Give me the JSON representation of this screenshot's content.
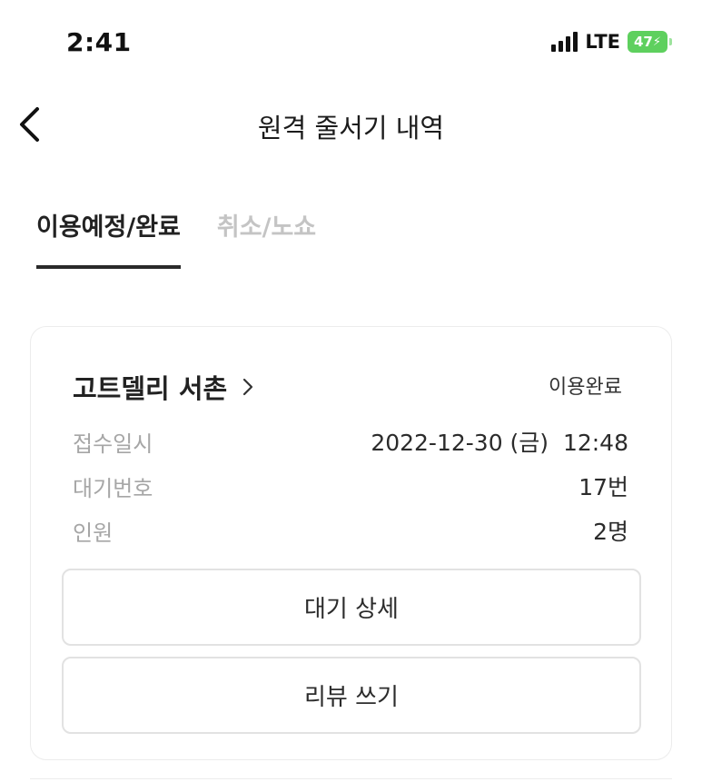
{
  "status_bar": {
    "time": "2:41",
    "network": "LTE",
    "battery_level": "47",
    "battery_color": "#5ed05e",
    "icons": [
      "signal-icon",
      "battery-charging-icon"
    ]
  },
  "header": {
    "back_icon": "chevron-left-icon",
    "title": "원격 줄서기 내역"
  },
  "tabs": [
    {
      "label": "이용예정/완료",
      "active": true
    },
    {
      "label": "취소/노쇼",
      "active": false
    }
  ],
  "reservation": {
    "store_name": "고트델리 서촌",
    "store_link_icon": "chevron-right-icon",
    "status": "이용완료",
    "rows": [
      {
        "label": "접수일시",
        "value": "2022-12-30 (금)  12:48"
      },
      {
        "label": "대기번호",
        "value": "17번"
      },
      {
        "label": "인원",
        "value": "2명"
      }
    ],
    "buttons": {
      "detail": "대기 상세",
      "review": "리뷰 쓰기"
    }
  }
}
